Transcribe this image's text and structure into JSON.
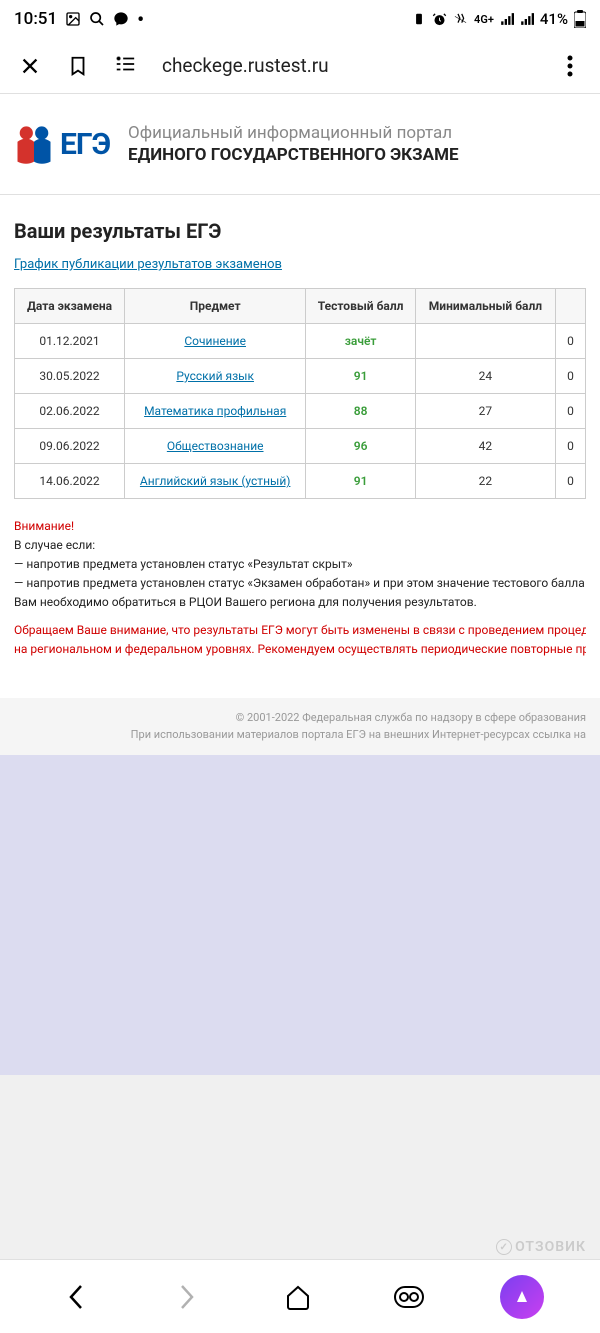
{
  "status_bar": {
    "time": "10:51",
    "battery_text": "41%"
  },
  "browser": {
    "url": "checkege.rustest.ru"
  },
  "header": {
    "logo_text": "ЕГЭ",
    "subtitle": "Официальный информационный портал",
    "title": "ЕДИНОГО ГОСУДАРСТВЕННОГО ЭКЗАМЕ"
  },
  "main": {
    "heading": "Ваши результаты ЕГЭ",
    "schedule_link": "График публикации результатов экзаменов",
    "table": {
      "headers": {
        "date": "Дата экзамена",
        "subject": "Предмет",
        "test_score": "Тестовый балл",
        "min_score": "Минимальный балл"
      },
      "rows": [
        {
          "date": "01.12.2021",
          "subject": "Сочинение",
          "score": "зачёт",
          "min": "",
          "extra": "0"
        },
        {
          "date": "30.05.2022",
          "subject": "Русский язык",
          "score": "91",
          "min": "24",
          "extra": "0"
        },
        {
          "date": "02.06.2022",
          "subject": "Математика профильная",
          "score": "88",
          "min": "27",
          "extra": "0"
        },
        {
          "date": "09.06.2022",
          "subject": "Обществознание",
          "score": "96",
          "min": "42",
          "extra": "0"
        },
        {
          "date": "14.06.2022",
          "subject": "Английский язык (устный)",
          "score": "91",
          "min": "22",
          "extra": "0"
        }
      ]
    },
    "attention": {
      "title": "Внимание!",
      "line1": "В случае если:",
      "line2": "— напротив предмета установлен статус «Результат скрыт»",
      "line3": "— напротив предмета установлен статус «Экзамен обработан» и при этом значение тестового балла пустое",
      "line4": "Вам необходимо обратиться в РЦОИ Вашего региона для получения результатов.",
      "red1": "Обращаем Ваше внимание, что результаты ЕГЭ могут быть изменены в связи с проведением процедур апелля",
      "red2": "на региональном и федеральном уровнях. Рекомендуем осуществлять периодические повторные проверки Ва"
    }
  },
  "footer": {
    "line1": "© 2001-2022 Федеральная служба по надзору в сфере образования",
    "line2": "При использовании материалов портала ЕГЭ на внешних Интернет-ресурсах ссылка на"
  },
  "watermark": {
    "text": "ОТЗОВИК"
  }
}
